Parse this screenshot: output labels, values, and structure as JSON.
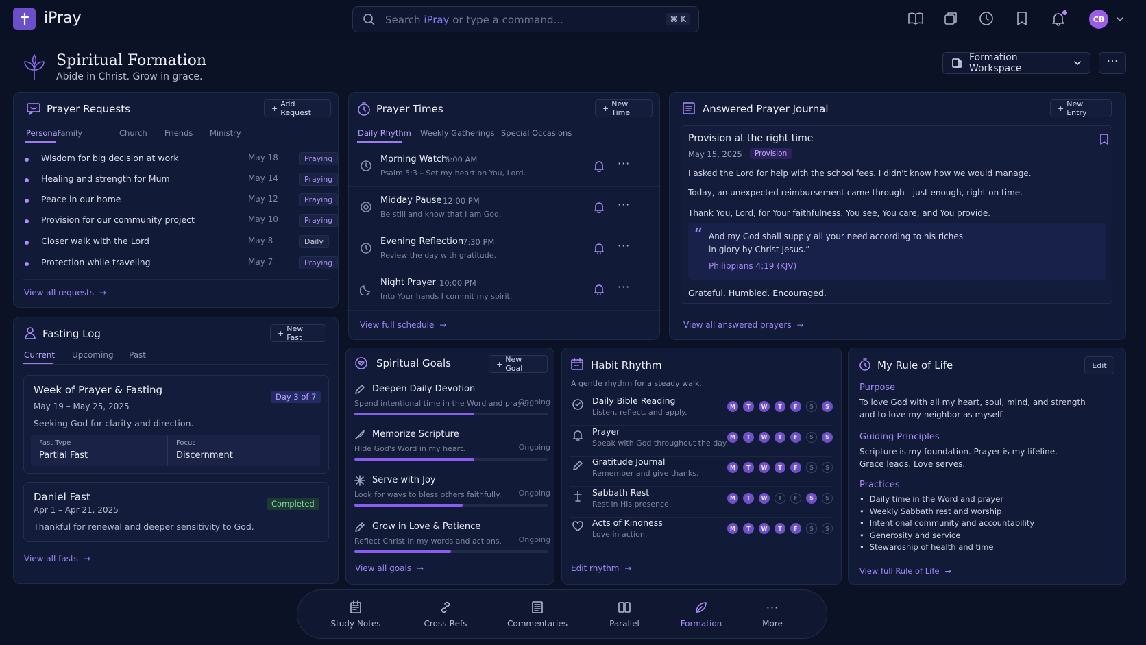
{
  "app": {
    "name": "iPray"
  },
  "search": {
    "prefix": "Search ",
    "brand": "iPray",
    "suffix": " or type a command...",
    "shortcut": "⌘ K"
  },
  "user": {
    "initials": "CB"
  },
  "header": {
    "title": "Spiritual Formation",
    "subtitle": "Abide in Christ. Grow in grace.",
    "workspace": "Formation Workspace",
    "more": "···"
  },
  "prayer_requests": {
    "title": "Prayer Requests",
    "add_label": "Add Request",
    "tabs": [
      "Personal",
      "Family",
      "Church",
      "Friends",
      "Ministry"
    ],
    "items": [
      {
        "text": "Wisdom for big decision at work",
        "date": "May 18",
        "status": "Praying"
      },
      {
        "text": "Healing and strength for Mum",
        "date": "May 14",
        "status": "Praying"
      },
      {
        "text": "Peace in our home",
        "date": "May 12",
        "status": "Praying"
      },
      {
        "text": "Provision for our community project",
        "date": "May 10",
        "status": "Praying"
      },
      {
        "text": "Closer walk with the Lord",
        "date": "May 8",
        "status": "Daily"
      },
      {
        "text": "Protection while traveling",
        "date": "May 7",
        "status": "Praying"
      }
    ],
    "view_all": "View all requests"
  },
  "prayer_times": {
    "title": "Prayer Times",
    "new_label": "New Time",
    "tabs": [
      "Daily Rhythm",
      "Weekly Gatherings",
      "Special Occasions"
    ],
    "items": [
      {
        "name": "Morning Watch",
        "time": "6:00 AM",
        "desc": "Psalm 5:3 – Set my heart on You, Lord."
      },
      {
        "name": "Midday Pause",
        "time": "12:00 PM",
        "desc": "Be still and know that I am God."
      },
      {
        "name": "Evening Reflection",
        "time": "7:30 PM",
        "desc": "Review the day with gratitude."
      },
      {
        "name": "Night Prayer",
        "time": "10:00 PM",
        "desc": "Into Your hands I commit my spirit."
      }
    ],
    "view_all": "View full schedule"
  },
  "journal": {
    "title": "Answered Prayer Journal",
    "new_label": "New Entry",
    "entry": {
      "title": "Provision at the right time",
      "date": "May 15, 2025",
      "tag": "Provision",
      "p1": "I asked the Lord for help with the school fees. I didn't know how we would manage.",
      "p2": "Today, an unexpected reimbursement came through—just enough, right on time.",
      "p3": "Thank You, Lord, for Your faithfulness. You see, You care, and You provide.",
      "quote_l1": "And my God shall supply all your need according to his riches",
      "quote_l2": "in glory by Christ Jesus.”",
      "ref": "Philippians 4:19 (KJV)",
      "closing": "Grateful. Humbled. Encouraged."
    },
    "view_all": "View all answered prayers"
  },
  "fasting": {
    "title": "Fasting Log",
    "new_label": "New Fast",
    "tabs": [
      "Current",
      "Upcoming",
      "Past"
    ],
    "current": {
      "title": "Week of Prayer & Fasting",
      "dates": "May 19 – May 25, 2025",
      "badge": "Day 3 of 7",
      "desc": "Seeking God for clarity and direction.",
      "type_label": "Fast Type",
      "type_value": "Partial Fast",
      "focus_label": "Focus",
      "focus_value": "Discernment"
    },
    "past": {
      "title": "Daniel Fast",
      "dates": "Apr 1 – Apr 21, 2025",
      "badge": "Completed",
      "desc": "Thankful for renewal and deeper sensitivity to God."
    },
    "view_all": "View all fasts"
  },
  "goals": {
    "title": "Spiritual Goals",
    "new_label": "New Goal",
    "items": [
      {
        "name": "Deepen Daily Devotion",
        "desc": "Spend intentional time in the Word and prayer.",
        "status": "Ongoing",
        "progress": 0.62
      },
      {
        "name": "Memorize Scripture",
        "desc": "Hide God's Word in my heart.",
        "status": "Ongoing",
        "progress": 0.62
      },
      {
        "name": "Serve with Joy",
        "desc": "Look for ways to bless others faithfully.",
        "status": "Ongoing",
        "progress": 0.56
      },
      {
        "name": "Grow in Love & Patience",
        "desc": "Reflect Christ in my words and actions.",
        "status": "Ongoing",
        "progress": 0.5
      }
    ],
    "view_all": "View all goals"
  },
  "habits": {
    "title": "Habit Rhythm",
    "subtitle": "A gentle rhythm for a steady walk.",
    "days": [
      "M",
      "T",
      "W",
      "T",
      "F",
      "S",
      "S"
    ],
    "items": [
      {
        "name": "Daily Bible Reading",
        "desc": "Listen, reflect, and apply.",
        "done": [
          1,
          1,
          1,
          1,
          1,
          0,
          1
        ]
      },
      {
        "name": "Prayer",
        "desc": "Speak with God throughout the day.",
        "done": [
          1,
          1,
          1,
          1,
          1,
          0,
          1
        ]
      },
      {
        "name": "Gratitude Journal",
        "desc": "Remember and give thanks.",
        "done": [
          1,
          1,
          1,
          1,
          1,
          0,
          0
        ]
      },
      {
        "name": "Sabbath Rest",
        "desc": "Rest in His presence.",
        "done": [
          1,
          1,
          1,
          0,
          0,
          1,
          0
        ]
      },
      {
        "name": "Acts of Kindness",
        "desc": "Love in action.",
        "done": [
          1,
          1,
          1,
          1,
          1,
          0,
          0
        ]
      }
    ],
    "edit_link": "Edit rhythm"
  },
  "rule": {
    "title": "My Rule of Life",
    "edit_label": "Edit",
    "purpose_h": "Purpose",
    "purpose_1": "To love God with all my heart, soul, mind, and strength",
    "purpose_2": "and to love my neighbor as myself.",
    "principles_h": "Guiding Principles",
    "principles_1": "Scripture is my foundation. Prayer is my lifeline.",
    "principles_2": "Grace leads. Love serves.",
    "practices_h": "Practices",
    "practices": [
      "Daily time in the Word and prayer",
      "Weekly Sabbath rest and worship",
      "Intentional community and accountability",
      "Generosity and service",
      "Stewardship of health and time"
    ],
    "view_all": "View full Rule of Life"
  },
  "dock": [
    "Study Notes",
    "Cross-Refs",
    "Commentaries",
    "Parallel",
    "Formation",
    "More"
  ],
  "colors": {
    "accent": "#9d7bf5",
    "background": "#0b1226",
    "card": "#111a36"
  }
}
